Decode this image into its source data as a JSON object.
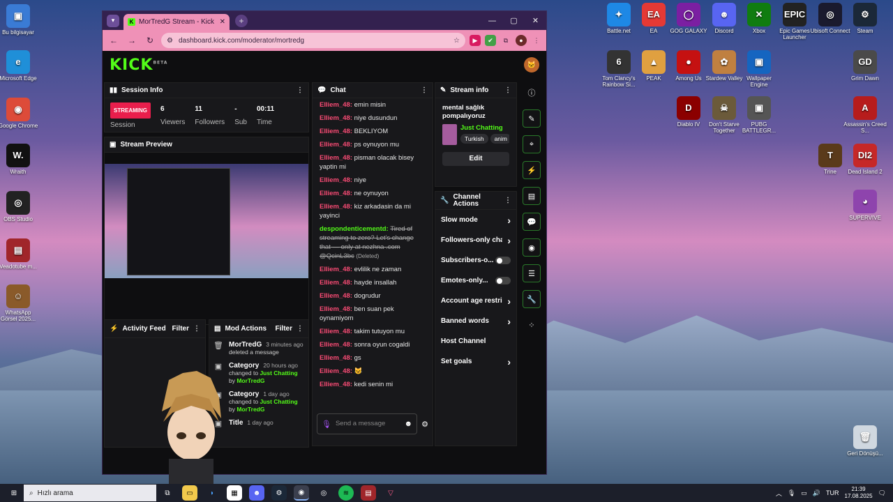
{
  "desktop": {
    "left_icons": [
      {
        "label": "Bu bilgisayar",
        "glyph": "▣",
        "color": "#3a7bd5"
      },
      {
        "label": "Microsoft Edge",
        "glyph": "e",
        "color": "#1f8fd8"
      },
      {
        "label": "Google Chrome",
        "glyph": "◉",
        "color": "#dd4b39"
      },
      {
        "label": "Wraith",
        "glyph": "W.",
        "color": "#111111"
      },
      {
        "label": "OBS Studio",
        "glyph": "◎",
        "color": "#222222"
      },
      {
        "label": "Veadotube m...",
        "glyph": "▤",
        "color": "#a0262a"
      },
      {
        "label": "WhatsApp Görsel 2025...",
        "glyph": "☺",
        "color": "#8a5a2a"
      }
    ],
    "right_icons": [
      {
        "label": "Battle.net",
        "glyph": "✦",
        "color": "#1e88e5"
      },
      {
        "label": "EA",
        "glyph": "EA",
        "color": "#e53935"
      },
      {
        "label": "GOG GALAXY",
        "glyph": "◯",
        "color": "#7b1fa2"
      },
      {
        "label": "Discord",
        "glyph": "☻",
        "color": "#5865f2"
      },
      {
        "label": "Xbox",
        "glyph": "✕",
        "color": "#107c10"
      },
      {
        "label": "Epic Games Launcher",
        "glyph": "EPIC",
        "color": "#222222"
      },
      {
        "label": "Ubisoft Connect",
        "glyph": "◎",
        "color": "#1a1a2e"
      },
      {
        "label": "Steam",
        "glyph": "⚙",
        "color": "#1b2838"
      },
      {
        "label": "Tom Clancy's Rainbow Si...",
        "glyph": "6",
        "color": "#333333"
      },
      {
        "label": "PEAK",
        "glyph": "▲",
        "color": "#e0a040"
      },
      {
        "label": "Among Us",
        "glyph": "●",
        "color": "#c51111"
      },
      {
        "label": "Stardew Valley",
        "glyph": "✿",
        "color": "#c08040"
      },
      {
        "label": "Wallpaper Engine",
        "glyph": "▣",
        "color": "#1565c0"
      },
      {
        "label": "Grim Dawn",
        "glyph": "GD",
        "color": "#4a4a4a"
      },
      {
        "label": "Diablo IV",
        "glyph": "D",
        "color": "#8b0000"
      },
      {
        "label": "Don't Starve Together",
        "glyph": "☠",
        "color": "#6b5a3a"
      },
      {
        "label": "PUBG BATTLEGR...",
        "glyph": "▣",
        "color": "#555555"
      },
      {
        "label": "Assassin's Creed S...",
        "glyph": "A",
        "color": "#b71c1c"
      },
      {
        "label": "Trine",
        "glyph": "T",
        "color": "#5a3a1a"
      },
      {
        "label": "Dead Island 2",
        "glyph": "DI2",
        "color": "#c62828"
      },
      {
        "label": "SUPERVIVE",
        "glyph": "◕",
        "color": "#8e44ad"
      },
      {
        "label": "Geri Dönüşü...",
        "glyph": "🗑",
        "color": "#d0d8e0"
      }
    ]
  },
  "browser": {
    "tab_title": "MorTredG Stream - Kick Dashbo",
    "url": "dashboard.kick.com/moderator/mortredg"
  },
  "kick": {
    "logo": "KICK",
    "logo_sup": "BETA",
    "session": {
      "title": "Session Info",
      "status": "STREAMING",
      "session_label": "Session",
      "stats": [
        {
          "value": "6",
          "label": "Viewers"
        },
        {
          "value": "11",
          "label": "Followers"
        },
        {
          "value": "-",
          "label": "Sub"
        },
        {
          "value": "00:11",
          "label": "Time"
        }
      ]
    },
    "preview_title": "Stream Preview",
    "chat": {
      "title": "Chat",
      "messages": [
        {
          "user": "Elliem_48",
          "text": "emin misin"
        },
        {
          "user": "Elliem_48",
          "text": "niye dusundun"
        },
        {
          "user": "Elliem_48",
          "text": "BEKLIYOM"
        },
        {
          "user": "Elliem_48",
          "text": "ps oynuyon mu"
        },
        {
          "user": "Elliem_48",
          "text": "pisman olacak bisey yaptin mi"
        },
        {
          "user": "Elliem_48",
          "text": "niye"
        },
        {
          "user": "Elliem_48",
          "text": "ne oynuyon"
        },
        {
          "user": "Elliem_48",
          "text": "kiz arkadasin da mi yayinci"
        }
      ],
      "deleted_user": "despondenticementd",
      "deleted_text": "Tired of streaming to zero? Let's change that — only at nezhna .com @QcinL3bc",
      "deleted_tag": "(Deleted)",
      "messages2": [
        {
          "user": "Elliem_48",
          "text": "evlilik ne zaman"
        },
        {
          "user": "Elliem_48",
          "text": "hayde insallah"
        },
        {
          "user": "Elliem_48",
          "text": "dogrudur"
        },
        {
          "user": "Elliem_48",
          "text": "ben suan pek oynamiyom"
        },
        {
          "user": "Elliem_48",
          "text": "takim tutuyon mu"
        },
        {
          "user": "Elliem_48",
          "text": "sonra oyun cogaldi"
        },
        {
          "user": "Elliem_48",
          "text": "gs"
        },
        {
          "user": "Elliem_48",
          "text": "😺"
        },
        {
          "user": "Elliem_48",
          "text": "kedi senin mi"
        }
      ],
      "placeholder": "Send a message"
    },
    "stream_info": {
      "title": "Stream info",
      "stream_title": "mental sağlık pompalıyoruz",
      "category": "Just Chatting",
      "tags": [
        "Turkish",
        "anim"
      ],
      "edit_label": "Edit"
    },
    "channel_actions": {
      "title": "Channel Actions",
      "items": [
        {
          "label": "Slow mode",
          "kind": "chevron"
        },
        {
          "label": "Followers-only cha",
          "kind": "chevron"
        },
        {
          "label": "Subscribers-o...",
          "kind": "toggle"
        },
        {
          "label": "Emotes-only...",
          "kind": "toggle"
        },
        {
          "label": "Account age restric",
          "kind": "chevron"
        },
        {
          "label": "Banned words",
          "kind": "chevron"
        },
        {
          "label": "Host Channel",
          "kind": "none"
        },
        {
          "label": "Set goals",
          "kind": "chevron"
        }
      ]
    },
    "activity": {
      "title": "Activity Feed",
      "filter": "Filter"
    },
    "mod_actions": {
      "title": "Mod Actions",
      "filter": "Filter",
      "items": [
        {
          "who": "MorTredG",
          "time": "3 minutes ago",
          "line1": "deleted a message",
          "cat": "",
          "by": ""
        },
        {
          "who": "Category",
          "time": "20 hours ago",
          "line1": "changed to",
          "cat": "Just Chatting",
          "by": "MorTredG"
        },
        {
          "who": "Category",
          "time": "1 day ago",
          "line1": "changed to",
          "cat": "Just Chatting",
          "by": "MorTredG"
        },
        {
          "who": "Title",
          "time": "1 day ago",
          "line1": "",
          "cat": "",
          "by": ""
        }
      ]
    }
  },
  "taskbar": {
    "search_placeholder": "Hızlı arama",
    "lang": "TUR",
    "time": "21:39",
    "date": "17.08.2025"
  }
}
